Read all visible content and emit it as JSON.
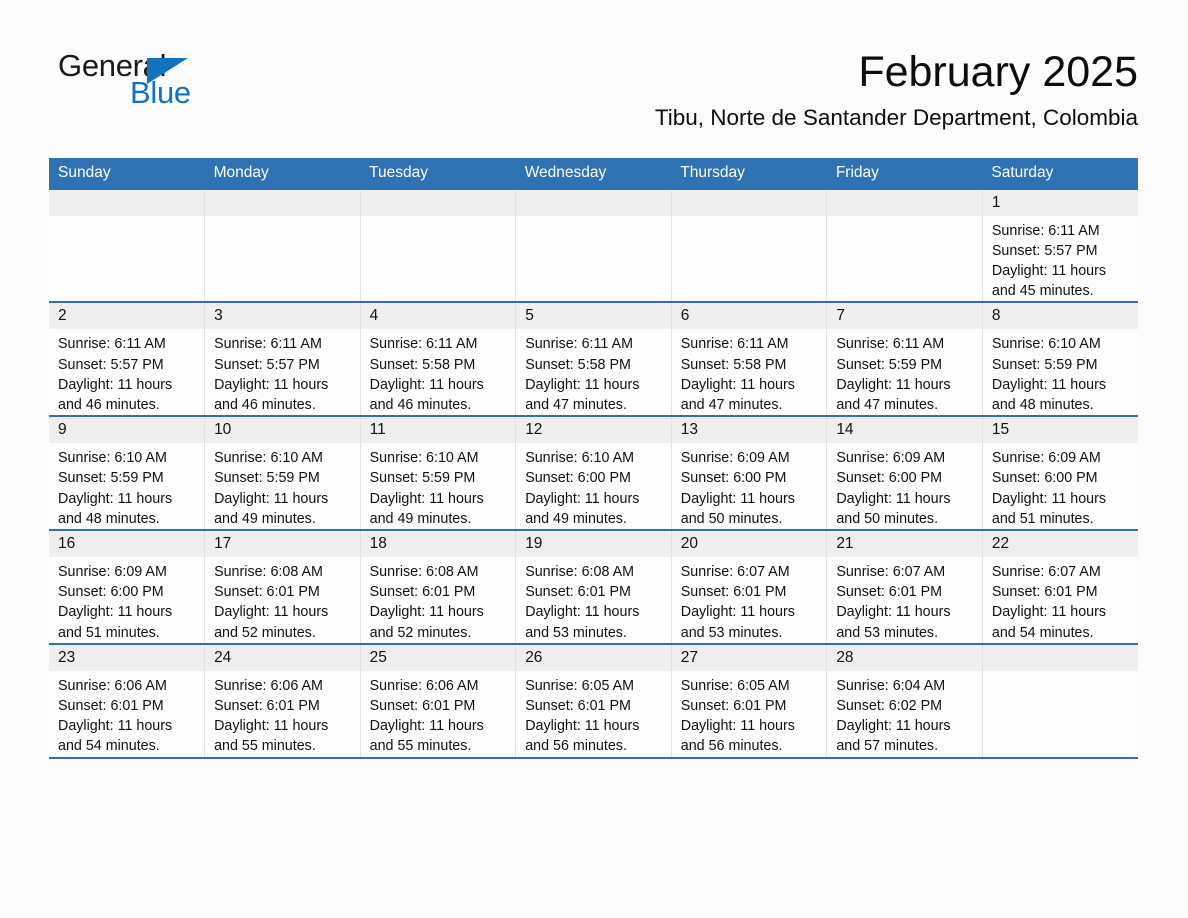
{
  "brand": {
    "name_part1": "General",
    "name_part2": "Blue",
    "accent_color": "#1272bd"
  },
  "header": {
    "month_title": "February 2025",
    "location": "Tibu, Norte de Santander Department, Colombia"
  },
  "theme": {
    "header_blue": "#2e72b3",
    "daynum_band": "#efefef",
    "page_background": "#fcfcfc"
  },
  "calendar": {
    "weekday_headers": [
      "Sunday",
      "Monday",
      "Tuesday",
      "Wednesday",
      "Thursday",
      "Friday",
      "Saturday"
    ],
    "weeks": [
      [
        {
          "day": "",
          "lines": []
        },
        {
          "day": "",
          "lines": []
        },
        {
          "day": "",
          "lines": []
        },
        {
          "day": "",
          "lines": []
        },
        {
          "day": "",
          "lines": []
        },
        {
          "day": "",
          "lines": []
        },
        {
          "day": "1",
          "lines": [
            "Sunrise: 6:11 AM",
            "Sunset: 5:57 PM",
            "Daylight: 11 hours and 45 minutes."
          ]
        }
      ],
      [
        {
          "day": "2",
          "lines": [
            "Sunrise: 6:11 AM",
            "Sunset: 5:57 PM",
            "Daylight: 11 hours and 46 minutes."
          ]
        },
        {
          "day": "3",
          "lines": [
            "Sunrise: 6:11 AM",
            "Sunset: 5:57 PM",
            "Daylight: 11 hours and 46 minutes."
          ]
        },
        {
          "day": "4",
          "lines": [
            "Sunrise: 6:11 AM",
            "Sunset: 5:58 PM",
            "Daylight: 11 hours and 46 minutes."
          ]
        },
        {
          "day": "5",
          "lines": [
            "Sunrise: 6:11 AM",
            "Sunset: 5:58 PM",
            "Daylight: 11 hours and 47 minutes."
          ]
        },
        {
          "day": "6",
          "lines": [
            "Sunrise: 6:11 AM",
            "Sunset: 5:58 PM",
            "Daylight: 11 hours and 47 minutes."
          ]
        },
        {
          "day": "7",
          "lines": [
            "Sunrise: 6:11 AM",
            "Sunset: 5:59 PM",
            "Daylight: 11 hours and 47 minutes."
          ]
        },
        {
          "day": "8",
          "lines": [
            "Sunrise: 6:10 AM",
            "Sunset: 5:59 PM",
            "Daylight: 11 hours and 48 minutes."
          ]
        }
      ],
      [
        {
          "day": "9",
          "lines": [
            "Sunrise: 6:10 AM",
            "Sunset: 5:59 PM",
            "Daylight: 11 hours and 48 minutes."
          ]
        },
        {
          "day": "10",
          "lines": [
            "Sunrise: 6:10 AM",
            "Sunset: 5:59 PM",
            "Daylight: 11 hours and 49 minutes."
          ]
        },
        {
          "day": "11",
          "lines": [
            "Sunrise: 6:10 AM",
            "Sunset: 5:59 PM",
            "Daylight: 11 hours and 49 minutes."
          ]
        },
        {
          "day": "12",
          "lines": [
            "Sunrise: 6:10 AM",
            "Sunset: 6:00 PM",
            "Daylight: 11 hours and 49 minutes."
          ]
        },
        {
          "day": "13",
          "lines": [
            "Sunrise: 6:09 AM",
            "Sunset: 6:00 PM",
            "Daylight: 11 hours and 50 minutes."
          ]
        },
        {
          "day": "14",
          "lines": [
            "Sunrise: 6:09 AM",
            "Sunset: 6:00 PM",
            "Daylight: 11 hours and 50 minutes."
          ]
        },
        {
          "day": "15",
          "lines": [
            "Sunrise: 6:09 AM",
            "Sunset: 6:00 PM",
            "Daylight: 11 hours and 51 minutes."
          ]
        }
      ],
      [
        {
          "day": "16",
          "lines": [
            "Sunrise: 6:09 AM",
            "Sunset: 6:00 PM",
            "Daylight: 11 hours and 51 minutes."
          ]
        },
        {
          "day": "17",
          "lines": [
            "Sunrise: 6:08 AM",
            "Sunset: 6:01 PM",
            "Daylight: 11 hours and 52 minutes."
          ]
        },
        {
          "day": "18",
          "lines": [
            "Sunrise: 6:08 AM",
            "Sunset: 6:01 PM",
            "Daylight: 11 hours and 52 minutes."
          ]
        },
        {
          "day": "19",
          "lines": [
            "Sunrise: 6:08 AM",
            "Sunset: 6:01 PM",
            "Daylight: 11 hours and 53 minutes."
          ]
        },
        {
          "day": "20",
          "lines": [
            "Sunrise: 6:07 AM",
            "Sunset: 6:01 PM",
            "Daylight: 11 hours and 53 minutes."
          ]
        },
        {
          "day": "21",
          "lines": [
            "Sunrise: 6:07 AM",
            "Sunset: 6:01 PM",
            "Daylight: 11 hours and 53 minutes."
          ]
        },
        {
          "day": "22",
          "lines": [
            "Sunrise: 6:07 AM",
            "Sunset: 6:01 PM",
            "Daylight: 11 hours and 54 minutes."
          ]
        }
      ],
      [
        {
          "day": "23",
          "lines": [
            "Sunrise: 6:06 AM",
            "Sunset: 6:01 PM",
            "Daylight: 11 hours and 54 minutes."
          ]
        },
        {
          "day": "24",
          "lines": [
            "Sunrise: 6:06 AM",
            "Sunset: 6:01 PM",
            "Daylight: 11 hours and 55 minutes."
          ]
        },
        {
          "day": "25",
          "lines": [
            "Sunrise: 6:06 AM",
            "Sunset: 6:01 PM",
            "Daylight: 11 hours and 55 minutes."
          ]
        },
        {
          "day": "26",
          "lines": [
            "Sunrise: 6:05 AM",
            "Sunset: 6:01 PM",
            "Daylight: 11 hours and 56 minutes."
          ]
        },
        {
          "day": "27",
          "lines": [
            "Sunrise: 6:05 AM",
            "Sunset: 6:01 PM",
            "Daylight: 11 hours and 56 minutes."
          ]
        },
        {
          "day": "28",
          "lines": [
            "Sunrise: 6:04 AM",
            "Sunset: 6:02 PM",
            "Daylight: 11 hours and 57 minutes."
          ]
        },
        {
          "day": "",
          "lines": []
        }
      ]
    ]
  }
}
